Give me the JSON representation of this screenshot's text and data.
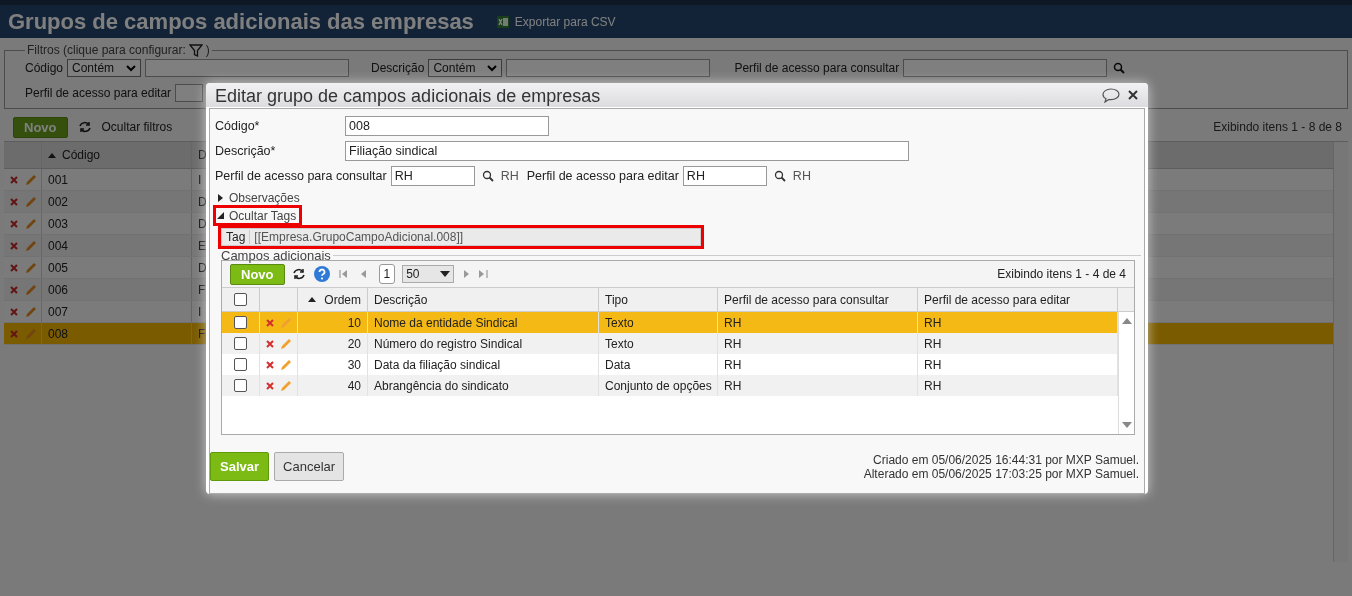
{
  "page": {
    "title": "Grupos de campos adicionais das empresas",
    "export_label": "Exportar para CSV"
  },
  "filters": {
    "legend": "Filtros (clique para configurar:",
    "legend_end": ")",
    "codigo": {
      "label": "Código",
      "operator": "Contém"
    },
    "descricao": {
      "label": "Descrição",
      "operator": "Contém"
    },
    "perfil_consultar": {
      "label": "Perfil de acesso para consultar"
    },
    "perfil_editar": {
      "label": "Perfil de acesso para editar"
    }
  },
  "toolbar": {
    "new_button": "Novo",
    "hide_filters": "Ocultar filtros",
    "count": "Exibindo itens 1 - 8 de 8"
  },
  "grid": {
    "columns": [
      "Código",
      "D"
    ],
    "rows": [
      {
        "code": "001",
        "description": "I",
        "selected": false
      },
      {
        "code": "002",
        "description": "D",
        "selected": false
      },
      {
        "code": "003",
        "description": "D",
        "selected": false
      },
      {
        "code": "004",
        "description": "E",
        "selected": false
      },
      {
        "code": "005",
        "description": "D",
        "selected": false
      },
      {
        "code": "006",
        "description": "F",
        "selected": false
      },
      {
        "code": "007",
        "description": "I",
        "selected": false
      },
      {
        "code": "008",
        "description": "F",
        "selected": true
      }
    ]
  },
  "modal": {
    "title": "Editar grupo de campos adicionais de empresas",
    "codigo": {
      "label": "Código*",
      "value": "008"
    },
    "descricao": {
      "label": "Descrição*",
      "value": "Filiação sindical"
    },
    "perfil_consultar": {
      "label": "Perfil de acesso para consultar",
      "value": "RH",
      "display": "RH"
    },
    "perfil_editar": {
      "label": "Perfil de acesso para editar",
      "value": "RH",
      "display": "RH"
    },
    "observacoes": {
      "label": "Observações",
      "expanded": false
    },
    "tags": {
      "label": "Ocultar Tags",
      "expanded": true,
      "highlighted": true,
      "tag_label": "Tag",
      "tag_value": "[[Empresa.GrupoCampoAdicional.008]]",
      "tag_highlighted": true
    },
    "subgrid": {
      "legend": "Campos adicionais",
      "new_button": "Novo",
      "page": "1",
      "page_size": "50",
      "count": "Exibindo itens 1 - 4 de 4",
      "select_all_checked": false,
      "columns": [
        "Ordem",
        "Descrição",
        "Tipo",
        "Perfil de acesso para consultar",
        "Perfil de acesso para editar"
      ],
      "rows": [
        {
          "checked": false,
          "selected": true,
          "order": "10",
          "description": "Nome da entidade Sindical",
          "type": "Texto",
          "view": "RH",
          "edit": "RH"
        },
        {
          "checked": false,
          "selected": false,
          "order": "20",
          "description": "Número do registro Sindical",
          "type": "Texto",
          "view": "RH",
          "edit": "RH"
        },
        {
          "checked": false,
          "selected": false,
          "order": "30",
          "description": "Data da filiação sindical",
          "type": "Data",
          "view": "RH",
          "edit": "RH"
        },
        {
          "checked": false,
          "selected": false,
          "order": "40",
          "description": "Abrangência do sindicato",
          "type": "Conjunto de opções",
          "view": "RH",
          "edit": "RH"
        }
      ]
    },
    "save_button": "Salvar",
    "cancel_button": "Cancelar",
    "created": "Criado em 05/06/2025 16:44:31 por MXP Samuel.",
    "modified": "Alterado em 05/06/2025 17:03:25 por MXP Samuel."
  }
}
